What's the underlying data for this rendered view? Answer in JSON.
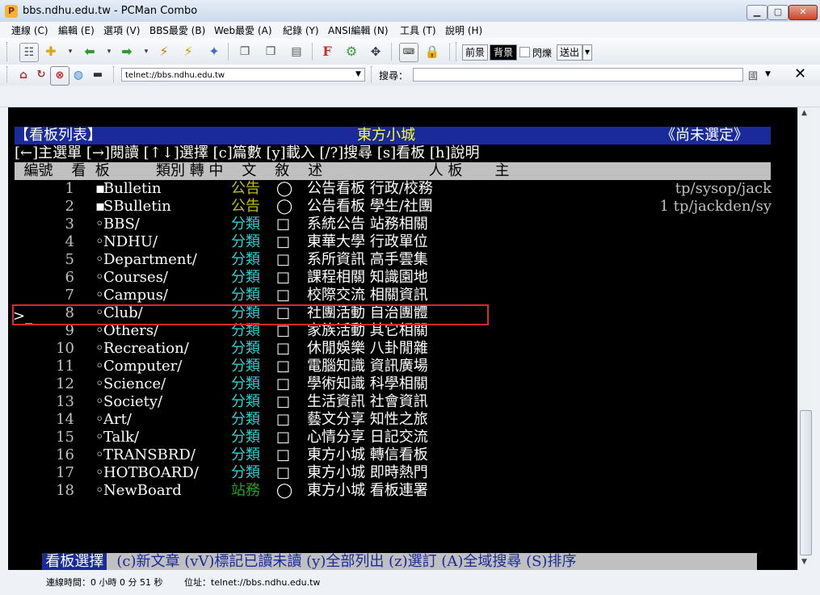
{
  "window": {
    "title": "bbs.ndhu.edu.tw - PCMan Combo",
    "app_icon": "pcman-logo-icon"
  },
  "menu": [
    "連線 (C)",
    "編輯 (E)",
    "選項 (V)",
    "BBS最愛 (B)",
    "Web最愛 (A)",
    "紀錄 (Y)",
    "ANSI編輯 (N)",
    "工具 (T)",
    "說明 (H)"
  ],
  "toolbar": {
    "fg_label": "前景",
    "bg_label": "背景",
    "blink_label": "閃爍",
    "send_label": "送出"
  },
  "addressbar": {
    "url": "telnet://bbs.ndhu.edu.tw",
    "search_label": "搜尋：",
    "search_value": "",
    "search_engine": "國"
  },
  "terminal": {
    "header_left": "【看板列表】",
    "header_mid": "東方小城",
    "header_right": "《尚未選定》",
    "help_line": "[←]主選單 [→]閱讀 [↑↓]選擇 [c]篇數 [y]載入 [/?]搜尋 [s]看板 [h]說明",
    "col_header": "  編號    看  板          類別 轉 中    文    敘    述                       人 板       主",
    "cursor": ">_",
    "rows": [
      {
        "num": "1",
        "mark": "▪",
        "name": "Bulletin",
        "cat": "公告",
        "sym": "◯",
        "desc": "公告看板 行政/校務",
        "extra": "tp/sysop/jack"
      },
      {
        "num": "2",
        "mark": "▪",
        "name": "SBulletin",
        "cat": "公告",
        "sym": "◯",
        "desc": "公告看板 學生/社團",
        "extra": "1 tp/jackden/sy"
      },
      {
        "num": "3",
        "mark": "◦",
        "name": "BBS/",
        "cat": "分類",
        "sym": "□",
        "desc": "系統公告 站務相關",
        "extra": ""
      },
      {
        "num": "4",
        "mark": "◦",
        "name": "NDHU/",
        "cat": "分類",
        "sym": "□",
        "desc": "東華大學 行政單位",
        "extra": ""
      },
      {
        "num": "5",
        "mark": "◦",
        "name": "Department/",
        "cat": "分類",
        "sym": "□",
        "desc": "系所資訊 高手雲集",
        "extra": ""
      },
      {
        "num": "6",
        "mark": "◦",
        "name": "Courses/",
        "cat": "分類",
        "sym": "□",
        "desc": "課程相關 知識園地",
        "extra": ""
      },
      {
        "num": "7",
        "mark": "◦",
        "name": "Campus/",
        "cat": "分類",
        "sym": "□",
        "desc": "校際交流 相關資訊",
        "extra": ""
      },
      {
        "num": "8",
        "mark": "◦",
        "name": "Club/",
        "cat": "分類",
        "sym": "□",
        "desc": "社團活動 自治團體",
        "extra": ""
      },
      {
        "num": "9",
        "mark": "◦",
        "name": "Others/",
        "cat": "分類",
        "sym": "□",
        "desc": "家族活動 其它相關",
        "extra": ""
      },
      {
        "num": "10",
        "mark": "◦",
        "name": "Recreation/",
        "cat": "分類",
        "sym": "□",
        "desc": "休閒娛樂 八卦閒雜",
        "extra": ""
      },
      {
        "num": "11",
        "mark": "◦",
        "name": "Computer/",
        "cat": "分類",
        "sym": "□",
        "desc": "電腦知識 資訊廣場",
        "extra": ""
      },
      {
        "num": "12",
        "mark": "◦",
        "name": "Science/",
        "cat": "分類",
        "sym": "□",
        "desc": "學術知識 科學相關",
        "extra": ""
      },
      {
        "num": "13",
        "mark": "◦",
        "name": "Society/",
        "cat": "分類",
        "sym": "□",
        "desc": "生活資訊 社會資訊",
        "extra": ""
      },
      {
        "num": "14",
        "mark": "◦",
        "name": "Art/",
        "cat": "分類",
        "sym": "□",
        "desc": "藝文分享 知性之旅",
        "extra": ""
      },
      {
        "num": "15",
        "mark": "◦",
        "name": "Talk/",
        "cat": "分類",
        "sym": "□",
        "desc": "心情分享 日記交流",
        "extra": ""
      },
      {
        "num": "16",
        "mark": "◦",
        "name": "TRANSBRD/",
        "cat": "分類",
        "sym": "□",
        "desc": "東方小城 轉信看板",
        "extra": ""
      },
      {
        "num": "17",
        "mark": "◦",
        "name": "HOTBOARD/",
        "cat": "分類",
        "sym": "□",
        "desc": "東方小城 即時熱門",
        "extra": ""
      },
      {
        "num": "18",
        "mark": "◦",
        "name": "NewBoard",
        "cat": "站務",
        "sym": "◯",
        "desc": "東方小城 看板連署",
        "extra": ""
      }
    ],
    "footer_label": "看板選擇",
    "footer_help": "(c)新文章 (vV)標記已讀未讀 (y)全部列出 (z)選訂 (A)全域搜尋 (S)排序"
  },
  "status": {
    "time": "連線時間：0 小時 0 分 51 秒",
    "address": "位址：telnet://bbs.ndhu.edu.tw"
  }
}
